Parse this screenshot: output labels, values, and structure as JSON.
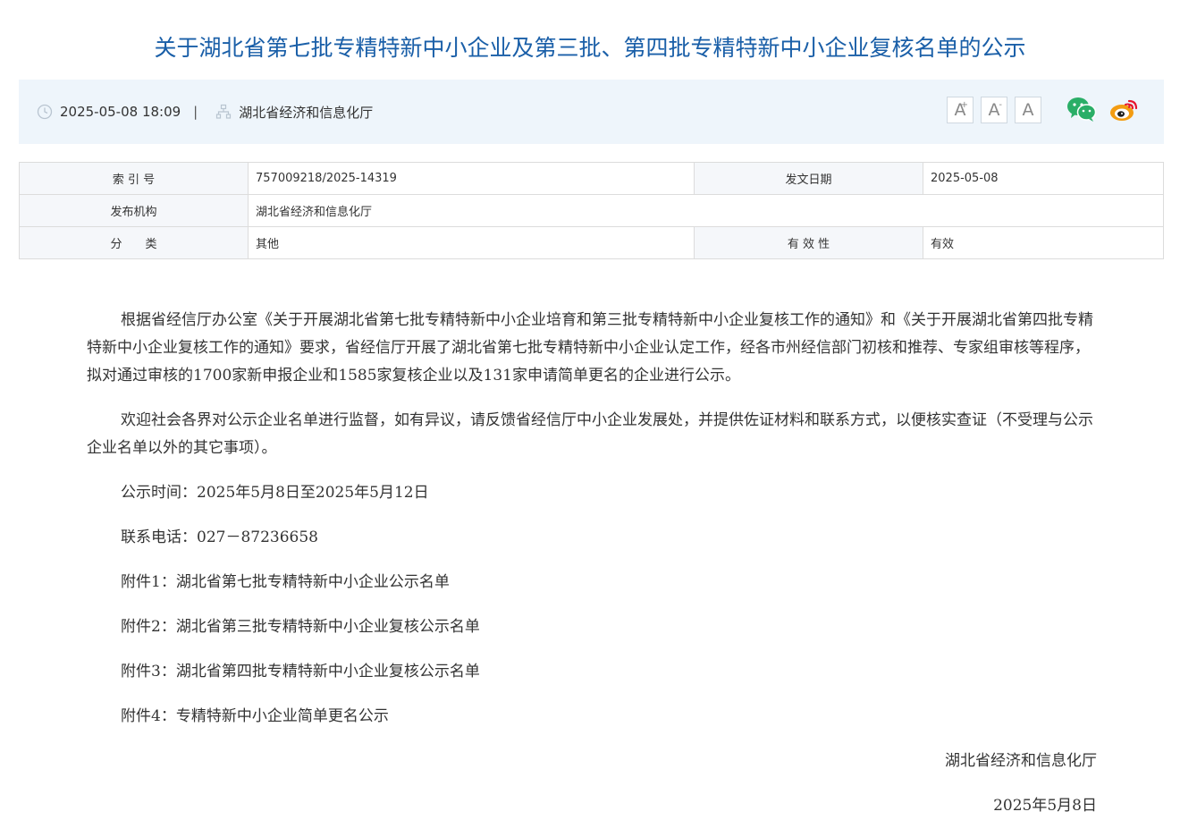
{
  "title": "关于湖北省第七批专精特新中小企业及第三批、第四批专精特新中小企业复核名单的公示",
  "info": {
    "datetime": "2025-05-08 18:09",
    "separator": "|",
    "source": "湖北省经济和信息化厅",
    "font_large": "A",
    "font_large_mark": "+",
    "font_small": "A",
    "font_small_mark": "-",
    "font_reset": "A",
    "icons": [
      "clock-icon",
      "org-icon",
      "wechat-icon",
      "weibo-icon"
    ],
    "colors": {
      "wechat": "#2aae67",
      "weibo": "#e6162d",
      "weibo_ring": "#f39c12"
    }
  },
  "meta": {
    "index_label": "索 引 号",
    "index_value": "757009218/2025-14319",
    "date_label": "发文日期",
    "date_value": "2025-05-08",
    "publisher_label": "发布机构",
    "publisher_value": "湖北省经济和信息化厅",
    "category_label": "分　　类",
    "category_value": "其他",
    "validity_label": "有 效 性",
    "validity_value": "有效"
  },
  "content": {
    "p1": "根据省经信厅办公室《关于开展湖北省第七批专精特新中小企业培育和第三批专精特新中小企业复核工作的通知》和《关于开展湖北省第四批专精特新中小企业复核工作的通知》要求，省经信厅开展了湖北省第七批专精特新中小企业认定工作，经各市州经信部门初核和推荐、专家组审核等程序，拟对通过审核的1700家新申报企业和1585家复核企业以及131家申请简单更名的企业进行公示。",
    "p2": "欢迎社会各界对公示企业名单进行监督，如有异议，请反馈省经信厅中小企业发展处，并提供佐证材料和联系方式，以便核实查证（不受理与公示企业名单以外的其它事项）。",
    "period": "公示时间：2025年5月8日至2025年5月12日",
    "phone": "联系电话：027－87236658",
    "attachments": [
      "附件1：湖北省第七批专精特新中小企业公示名单",
      "附件2：湖北省第三批专精特新中小企业复核公示名单",
      "附件3：湖北省第四批专精特新中小企业复核公示名单",
      "附件4：专精特新中小企业简单更名公示"
    ],
    "sign_org": "湖北省经济和信息化厅",
    "sign_date": "2025年5月8日"
  }
}
